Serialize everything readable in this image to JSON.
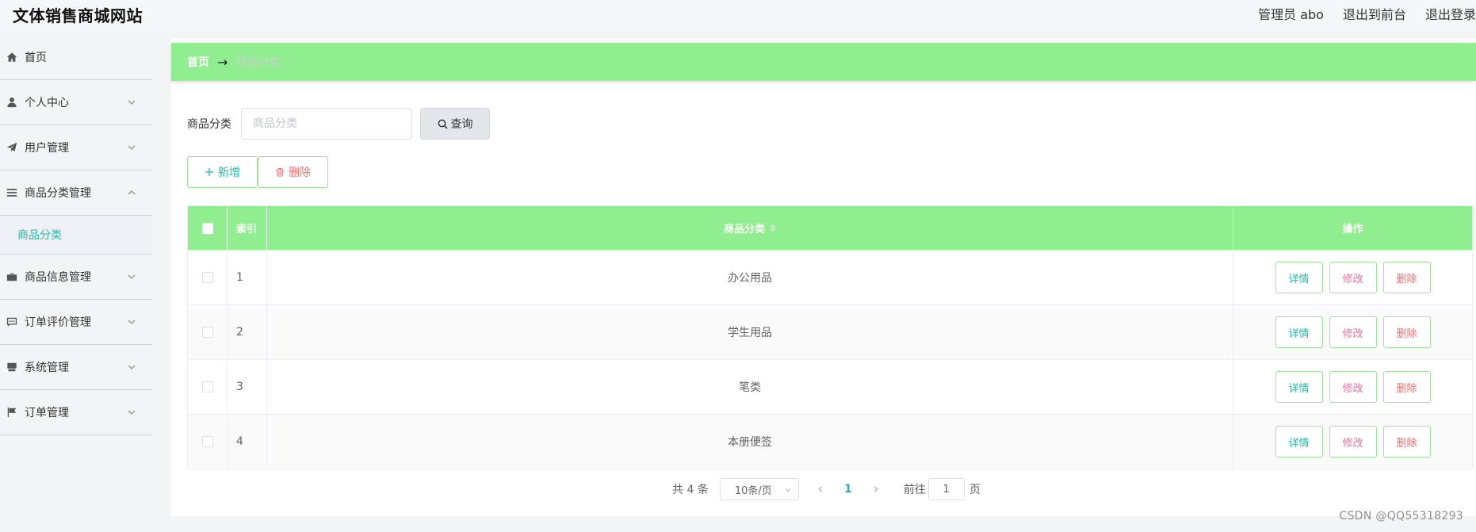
{
  "header": {
    "site_title": "文体销售商城网站",
    "admin_label": "管理员 abo",
    "back_to_front": "退出到前台",
    "logout": "退出登录"
  },
  "sidebar": {
    "items": [
      {
        "label": "首页",
        "icon": "home-icon"
      },
      {
        "label": "个人中心",
        "icon": "user-icon"
      },
      {
        "label": "用户管理",
        "icon": "paper-plane-icon"
      },
      {
        "label": "商品分类管理",
        "icon": "list-icon"
      },
      {
        "label": "商品信息管理",
        "icon": "briefcase-icon"
      },
      {
        "label": "订单评价管理",
        "icon": "chat-icon"
      },
      {
        "label": "系统管理",
        "icon": "server-icon"
      },
      {
        "label": "订单管理",
        "icon": "flag-icon"
      }
    ],
    "active_sub": "商品分类"
  },
  "breadcrumb": {
    "home": "首页",
    "arrow": "→",
    "current": "商品分类"
  },
  "search": {
    "label": "商品分类",
    "placeholder": "商品分类",
    "value": "",
    "button": "查询"
  },
  "actions": {
    "add": "新增",
    "delete": "删除"
  },
  "table": {
    "columns": [
      "索引",
      "商品分类",
      "操作"
    ],
    "rows": [
      {
        "index": "1",
        "name": "办公用品"
      },
      {
        "index": "2",
        "name": "学生用品"
      },
      {
        "index": "3",
        "name": "笔类"
      },
      {
        "index": "4",
        "name": "本册便签"
      }
    ],
    "op_detail": "详情",
    "op_edit": "修改",
    "op_delete": "删除"
  },
  "pagination": {
    "total": "共 4 条",
    "page_size": "10条/页",
    "current_page": "1",
    "goto_prefix": "前往",
    "goto_value": "1",
    "goto_suffix": "页"
  },
  "watermark": "CSDN @QQ55318293",
  "colors": {
    "accent_green": "#90ee90",
    "teal": "#27b6a4",
    "danger": "#f56c6c",
    "edit_pink": "#f56c9a"
  }
}
